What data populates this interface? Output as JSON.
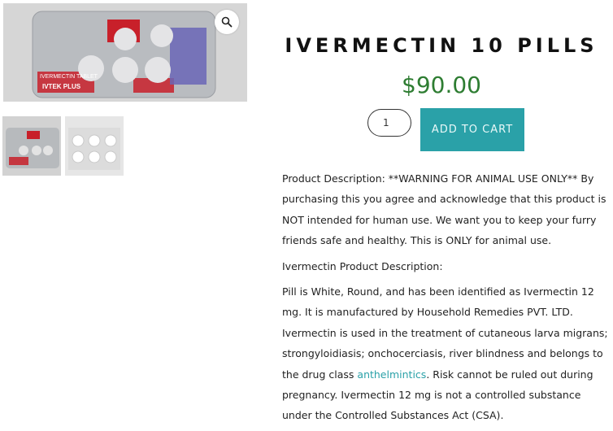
{
  "product": {
    "title": "IVERMECTIN 10 PILLS",
    "price": "$90.00",
    "quantity": "1",
    "add_to_cart_label": "ADD TO CART"
  },
  "gallery": {
    "main_image_label": "IVERMECTIN TABLET",
    "brand_label": "IVTEK PLUS",
    "zoom_icon": "search-icon",
    "thumbnails": [
      "blister-pack-thumbnail",
      "pills-thumbnail"
    ]
  },
  "description": {
    "p1": "Product Description: **WARNING FOR ANIMAL USE ONLY** By purchasing this you agree and acknowledge that this product is NOT intended for human use. We want you to keep your furry friends safe and healthy. This is ONLY for animal use.",
    "p2": "Ivermectin Product Description:",
    "p3_before": "Pill is White, Round, and has been identified as Ivermectin 12 mg. It is manufactured by Household Remedies PVT. LTD. Ivermectin is used in the treatment of cutaneous larva migrans; strongyloidiasis; onchocerciasis, river blindness and belongs to the drug class ",
    "p3_link": "anthelmintics",
    "p3_after": ". Risk cannot be ruled out during pregnancy. Ivermectin 12 mg is not a controlled substance under the Controlled Substances Act (CSA)."
  },
  "colors": {
    "accent": "#2aa1a8",
    "price": "#2e7d32"
  }
}
